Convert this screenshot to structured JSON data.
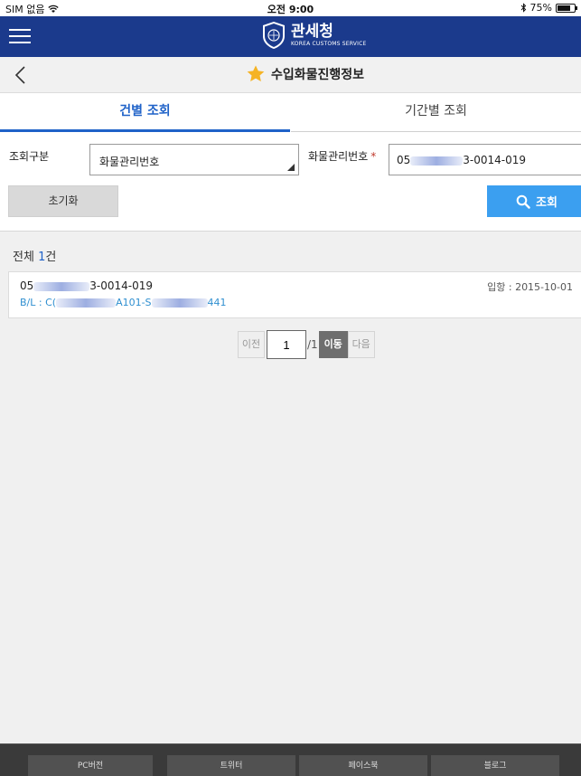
{
  "status_bar": {
    "carrier": "SIM 없음",
    "time": "오전 9:00",
    "battery": "75%",
    "battery_level": 0.75
  },
  "header": {
    "title_ko": "관세청",
    "title_en": "KOREA CUSTOMS SERVICE"
  },
  "sub_header": {
    "title": "수입화물진행정보"
  },
  "tabs": [
    {
      "label": "건별 조회",
      "active": true
    },
    {
      "label": "기간별 조회",
      "active": false
    }
  ],
  "form": {
    "category_label": "조회구분",
    "category_value": "화물관리번호",
    "cargo_no_label": "화물관리번호",
    "cargo_no_value_prefix": "05",
    "cargo_no_value_suffix": "3-0014-019",
    "reset_label": "초기화",
    "search_label": "조회"
  },
  "results": {
    "total_prefix": "전체",
    "total_count": "1",
    "total_suffix": "건",
    "items": [
      {
        "cargo_no_prefix": "05",
        "cargo_no_suffix": "3-0014-019",
        "bl_prefix": "B/L : C(",
        "bl_middle": "A101-S",
        "bl_suffix": "441",
        "arrival": "입항 : 2015-10-01"
      }
    ]
  },
  "pagination": {
    "prev_label": "이전",
    "current_page": "1",
    "total_pages": "/1",
    "go_label": "이동",
    "next_label": "다음"
  },
  "footer": {
    "links": [
      "PC버전",
      "트위터",
      "페이스북",
      "블로그"
    ]
  },
  "colors": {
    "header_blue": "#1b3a8c",
    "tab_active": "#1f62c8",
    "search_button": "#3b9ff0",
    "star": "#f5b324"
  }
}
